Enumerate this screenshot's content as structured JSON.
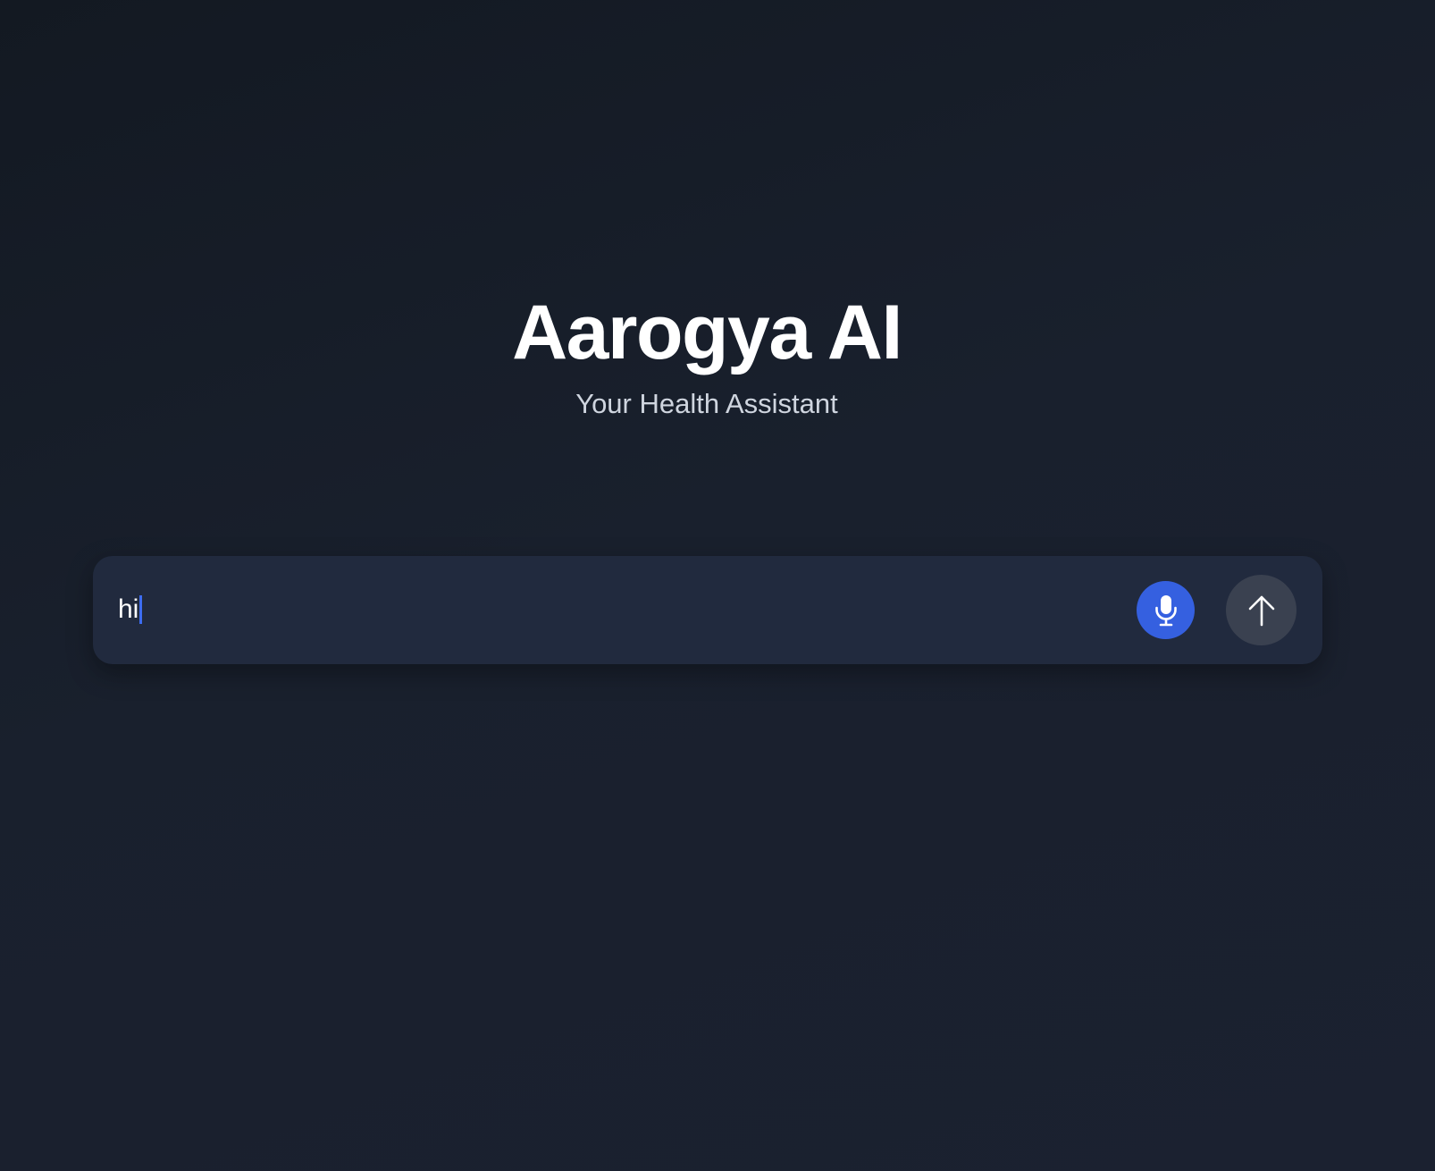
{
  "app": {
    "title": "Aarogya AI",
    "subtitle": "Your Health Assistant"
  },
  "chat_input": {
    "value": "hi",
    "placeholder": ""
  },
  "buttons": {
    "mic_icon": "microphone-icon",
    "send_icon": "arrow-up-icon"
  },
  "colors": {
    "background": "#161c27",
    "input_bar": "#212a3e",
    "mic_button": "#3560e0",
    "send_button": "#3a4150",
    "caret": "#3d6cf0"
  }
}
